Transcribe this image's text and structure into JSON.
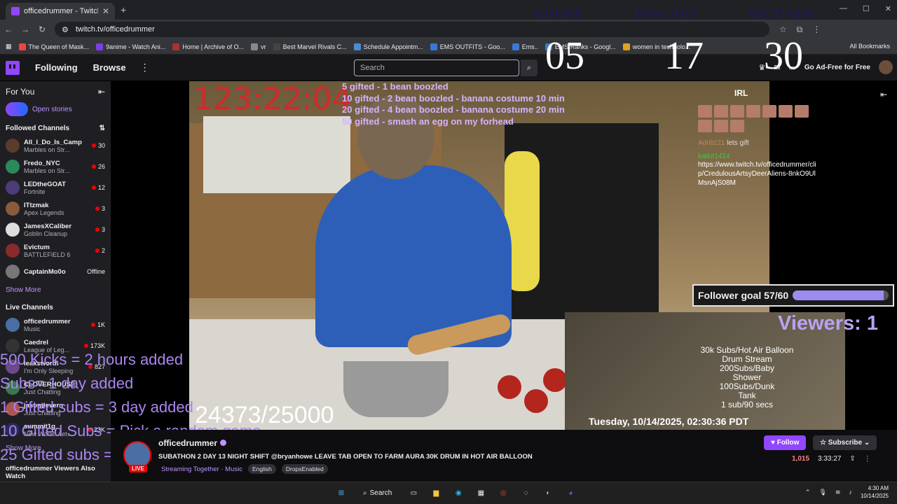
{
  "browser": {
    "tab_title": "officedrummer - Twitch",
    "url": "twitch.tv/officedrummer",
    "bookmarks": [
      "The Queen of Mask...",
      "9anime - Watch Ani...",
      "Home | Archive of O...",
      "vr",
      "Best Marvel Rivals C...",
      "Schedule Appointm...",
      "EMS OUTFITS - Goo...",
      "Ems..",
      "EMS Ranks - Googl...",
      "women in technolo..."
    ],
    "all_bookmarks": "All Bookmarks"
  },
  "twitch_nav": {
    "following": "Following",
    "browse": "Browse",
    "search_placeholder": "Search",
    "ad_free": "Go Ad-Free for Free"
  },
  "sidebar": {
    "for_you": "For You",
    "open_stories": "Open stories",
    "followed_header": "Followed Channels",
    "followed": [
      {
        "name": "All_I_Do_Is_Camp",
        "game": "Marbles on Str...",
        "viewers": "30"
      },
      {
        "name": "Fredo_NYC",
        "game": "Marbles on Str...",
        "viewers": "26"
      },
      {
        "name": "LEDtheGOAT",
        "game": "Fortnite",
        "viewers": "12"
      },
      {
        "name": "ITtzmak",
        "game": "Apex Legends",
        "viewers": "3"
      },
      {
        "name": "JamesXCaliber",
        "game": "Goblin Cleanup",
        "viewers": "3"
      },
      {
        "name": "Evictum",
        "game": "BATTLEFIELD 6",
        "viewers": "2"
      },
      {
        "name": "CaptainMo0o",
        "game": "",
        "viewers": "Offline"
      }
    ],
    "show_more": "Show More",
    "live_header": "Live Channels",
    "live": [
      {
        "name": "officedrummer",
        "game": "Music",
        "viewers": "1K"
      },
      {
        "name": "Caedrel",
        "game": "League of Leg...",
        "viewers": "173K"
      },
      {
        "name": "leakswordl",
        "game": "I'm Only Sleeping",
        "viewers": "827"
      },
      {
        "name": "CLOVERHOUSE",
        "game": "Just Chatting",
        "viewers": ""
      },
      {
        "name": "jasontlevern",
        "game": "Just Chatting",
        "viewers": ""
      },
      {
        "name": "summit1g",
        "game": "New World: Aet...",
        "viewers": "23K"
      }
    ],
    "show_more2": "Show More",
    "also_watch": "officedrummer Viewers Also Watch"
  },
  "overlay": {
    "big_timer": "123:22:04",
    "timer_labels": [
      "HOURS",
      "MINUTES",
      "SECONDS"
    ],
    "timer_values": [
      "05",
      "17",
      "30"
    ],
    "gift_lines": [
      {
        "n": "5",
        "text": "gifted - 1 bean boozled"
      },
      {
        "n": "10",
        "text": "gifted - 2 bean boozled - banana costume 10 min"
      },
      {
        "n": "20",
        "text": "gifted - 4 bean boozled - banana costume 20 min"
      },
      {
        "n": "50",
        "text": "gifted - smash an egg on my forhead"
      }
    ],
    "count": "24373/25000",
    "promo": [
      "500 Kicks = 2 hours added",
      "Subs= 1 day added",
      "1 Gifted subs = 3 day added",
      "10 Gifted Subs = Pick a random game",
      "25 Gifted subs = Playing Dramonologist"
    ],
    "irl_logo": "IRL",
    "chat_user1": "Adriliz21",
    "chat_msg1": "lets gift",
    "chat_user2": "katkit1414",
    "chat_link": "https://www.twitch.tv/officedrummer/clip/CredulousArtsyDeerAliens-8nkO9UlMsnAjS08M",
    "follower_goal": "Follower goal 57/60",
    "goal_fraction": 0.95,
    "viewers": "Viewers: 1",
    "inset_text": [
      "30k Subs/Hot Air Balloon",
      "Drum Stream",
      "200Subs/Baby",
      "Shower",
      "100Subs/Dunk",
      "Tank",
      "1 sub/90 secs"
    ],
    "datetime": "Tuesday, 10/14/2025, 02:30:36 PDT"
  },
  "stream": {
    "channel": "officedrummer",
    "live_badge": "LIVE",
    "title": "SUBATHON 2 DAY 13 NIGHT SHIFT @bryanhowe LEAVE TAB OPEN TO FARM AURA 30K DRUM IN HOT AIR BALLOON",
    "category": "Streaming Together · Music",
    "tags": [
      "English",
      "DropsEnabled"
    ],
    "follow": "Follow",
    "subscribe": "Subscribe",
    "viewer_count": "1,015",
    "uptime": "3:33:27"
  },
  "taskbar": {
    "search": "Search",
    "time": "4:30 AM",
    "date": "10/14/2025"
  }
}
